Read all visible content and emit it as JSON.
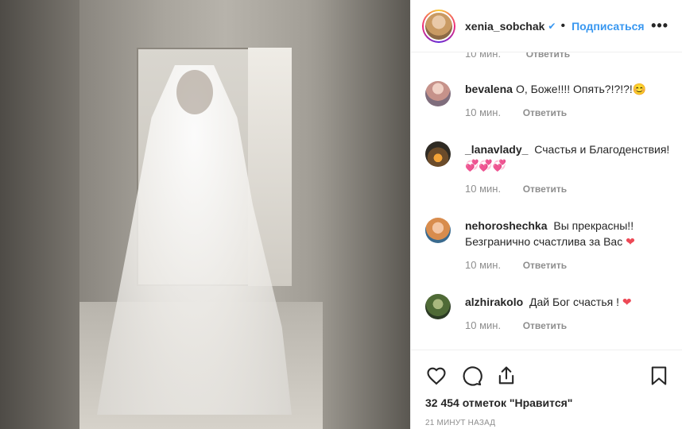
{
  "header": {
    "username": "xenia_sobchak",
    "verified_glyph": "✔",
    "separator": "•",
    "follow_label": "Подписаться",
    "more_glyph": "•••"
  },
  "partial_row": {
    "time": "10 мин.",
    "reply_label": "Ответить"
  },
  "comments": [
    {
      "user": "bevalena",
      "text": "О, Боже!!!! Опять?!?!?!",
      "emoji": "😊",
      "time": "10 мин.",
      "reply_label": "Ответить"
    },
    {
      "user": "_lanavlady_",
      "text": "Счастья и Благоденствия!",
      "emoji": "💞💞💞",
      "time": "10 мин.",
      "reply_label": "Ответить"
    },
    {
      "user": "nehoroshechka",
      "text": "Вы прекрасны!! Безгранично счастлива за Вас",
      "emoji": "❤",
      "time": "10 мин.",
      "reply_label": "Ответить"
    },
    {
      "user": "alzhirakolo",
      "text": "Дай Бог счастья !",
      "emoji": "❤",
      "time": "10 мин.",
      "reply_label": "Ответить"
    }
  ],
  "actions": {
    "likes": "32 454 отметок \"Нравится\"",
    "timestamp": "21 МИНУТ НАЗАД"
  },
  "icons": [
    "heart-icon",
    "comment-icon",
    "share-icon",
    "bookmark-icon",
    "more-options-icon"
  ]
}
